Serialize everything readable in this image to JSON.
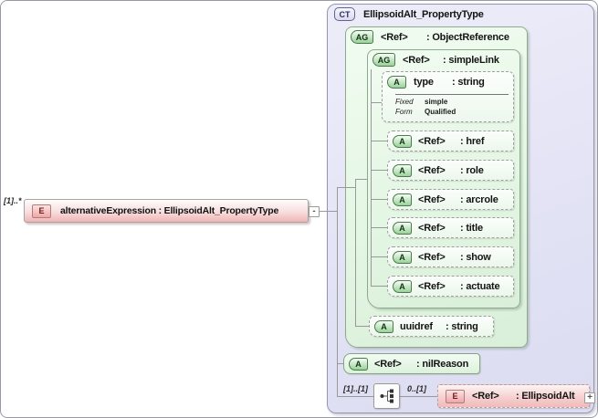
{
  "colors": {
    "complex_type_fill": "#e4e4f6",
    "group_fill": "#e7f7e7",
    "element_fill": "#f2bcbc",
    "badge_green": "#98d298",
    "badge_pink": "#efa6a6",
    "badge_blue": "#d9d9f1",
    "connector_line": "#999999"
  },
  "element_node": {
    "cardinality": "[1]..*",
    "badge": "E",
    "label": "alternativeExpression : EllipsoidAlt_PropertyType",
    "collapse_glyph": "-"
  },
  "complex_type": {
    "badge": "CT",
    "title": "EllipsoidAlt_PropertyType",
    "object_reference": {
      "badge": "AG",
      "ref": "<Ref>",
      "type": ": ObjectReference"
    },
    "simple_link": {
      "badge": "AG",
      "ref": "<Ref>",
      "type": ": simpleLink"
    },
    "type_attribute": {
      "badge": "A",
      "name": "type",
      "type": ": string",
      "fixed_label": "Fixed",
      "fixed_value": "simple",
      "form_label": "Form",
      "form_value": "Qualified"
    },
    "ref_attributes": [
      {
        "badge": "A",
        "ref": "<Ref>",
        "type": ": href"
      },
      {
        "badge": "A",
        "ref": "<Ref>",
        "type": ": role"
      },
      {
        "badge": "A",
        "ref": "<Ref>",
        "type": ": arcrole"
      },
      {
        "badge": "A",
        "ref": "<Ref>",
        "type": ": title"
      },
      {
        "badge": "A",
        "ref": "<Ref>",
        "type": ": show"
      },
      {
        "badge": "A",
        "ref": "<Ref>",
        "type": ": actuate"
      }
    ],
    "uuidref_attribute": {
      "badge": "A",
      "name": "uuidref",
      "type": ": string"
    },
    "nilreason_attribute": {
      "badge": "A",
      "ref": "<Ref>",
      "type": ": nilReason"
    },
    "sequence_row": {
      "cardinality_outer": "[1]..[1]",
      "cardinality_inner": "0..[1]",
      "ellipsoidalt_element": {
        "badge": "E",
        "ref": "<Ref>",
        "type": ": EllipsoidAlt",
        "expand_glyph": "+"
      }
    }
  }
}
